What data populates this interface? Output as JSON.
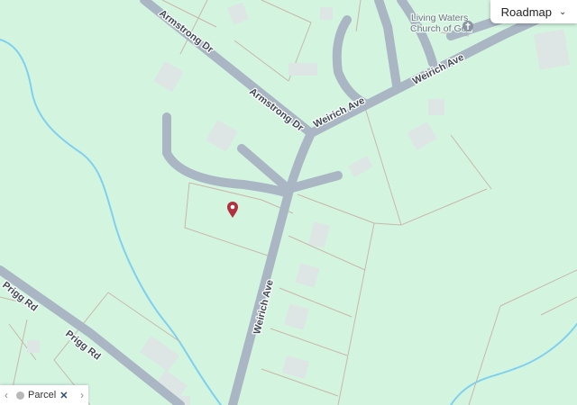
{
  "map": {
    "roads": {
      "armstrong": "Armstrong Dr",
      "weirich_upper": "Weirich Ave",
      "weirich_right": "Weirich Ave",
      "weirich_vertical": "Weirich Ave",
      "prigg_upper": "Prigg Rd",
      "prigg_lower": "Prigg Rd"
    },
    "poi": {
      "line1": "Living Waters",
      "line2": "Church of God",
      "icon": "church-cross-icon"
    },
    "marker": {
      "icon": "location-pin-icon",
      "color": "#b0303e"
    },
    "colors": {
      "land": "#d3f5e0",
      "road": "#aab6c4",
      "water": "#7fd0ee",
      "parcel_line": "#c9b7aa",
      "building": "#dde6e4"
    }
  },
  "controls": {
    "map_style": {
      "label": "Roadmap",
      "icon": "chevron-down-icon"
    },
    "layer_bar": {
      "prev_icon": "chevron-left-icon",
      "layer_label": "Parcel",
      "close_icon": "close-icon",
      "next_icon": "chevron-right-icon"
    }
  }
}
